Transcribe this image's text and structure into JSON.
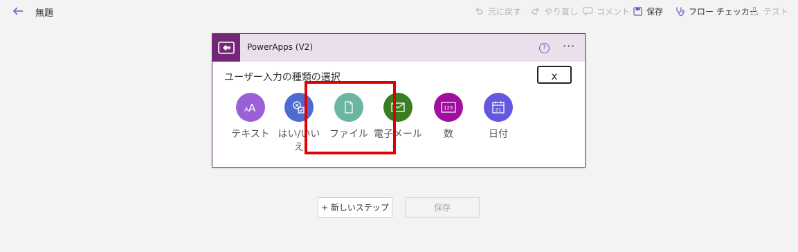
{
  "header": {
    "flow_name": "無題",
    "commands": {
      "undo": "元に戻す",
      "redo": "やり直し",
      "comment": "コメント",
      "save": "保存",
      "flow_checker": "フロー チェッカー",
      "test": "テスト"
    }
  },
  "trigger_card": {
    "title": "PowerApps (V2)",
    "help_glyph": "?",
    "more_glyph": "···",
    "prompt": "ユーザー入力の種類の選択",
    "close_label": "x",
    "input_types": [
      {
        "label": "テキスト",
        "color": "#9b5fd6",
        "icon": "text-icon"
      },
      {
        "label": "はい/いいえ",
        "color": "#4f6bd1",
        "icon": "yes-no-icon"
      },
      {
        "label": "ファイル",
        "color": "#6bb5a3",
        "icon": "file-icon"
      },
      {
        "label": "電子メール",
        "color": "#3a7d23",
        "icon": "email-icon"
      },
      {
        "label": "数",
        "color": "#a00fa0",
        "icon": "number-icon"
      },
      {
        "label": "日付",
        "color": "#6457e0",
        "icon": "date-icon"
      }
    ]
  },
  "actions": {
    "new_step": "+ 新しいステップ",
    "save": "保存"
  },
  "colors": {
    "accent": "#5b5fc7",
    "powerapps_brand": "#742774",
    "card_header_bg": "#eadfea",
    "highlight": "#e00000"
  }
}
